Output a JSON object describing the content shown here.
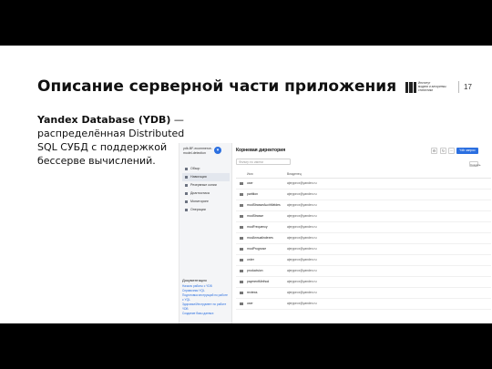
{
  "slide": {
    "title": "Описание серверной части приложения",
    "page_number": "17",
    "logo_text": "Институт\nмодели и алгоритмы\nстатистики",
    "desc_bold": "Yandex Database (YDB)",
    "desc_rest": " — распределённая Distributed SQL СУБД с поддержкой бессерве вычислений."
  },
  "console": {
    "db_name": "ydb-BF-ecommerce-\nmodel-detection",
    "nav": [
      {
        "label": "Обзор",
        "icon": "overview-icon"
      },
      {
        "label": "Навигация",
        "icon": "navigation-icon",
        "active": true
      },
      {
        "label": "Резервные копии",
        "icon": "backup-icon"
      },
      {
        "label": "Диагностика",
        "icon": "diagnostics-icon"
      },
      {
        "label": "Мониторинг",
        "icon": "monitoring-icon"
      },
      {
        "label": "Операции",
        "icon": "operations-icon"
      }
    ],
    "docs_heading": "Документация",
    "docs_links": [
      "Начало работы с YDB",
      "Справочник YQL",
      "Подготовка инструкций по работе с YQL",
      "Здоровье/Инструмент по работе YDB",
      "Создание базы данных"
    ],
    "page_title": "Корневая директория",
    "search_placeholder": "Фильтр по имени",
    "primary_button": "Ydb запрос",
    "secondary_button": "Создать",
    "columns": [
      "Имя",
      "Владелец"
    ],
    "rows": [
      {
        "name": "user",
        "owner": "ajerpprox@yandex.ru"
      },
      {
        "name": "partition",
        "owner": "ajerpprox@yandex.ru"
      },
      {
        "name": "modStrasseAuchMeldes",
        "owner": "ajerpprox@yandex.ru"
      },
      {
        "name": "modStrasse",
        "owner": "ajerpprox@yandex.ru"
      },
      {
        "name": "modFrequency",
        "owner": "ajerpprox@yandex.ru"
      },
      {
        "name": "modAnnualindexes",
        "owner": "ajerpprox@yandex.ru"
      },
      {
        "name": "modPrognose",
        "owner": "ajerpprox@yandex.ru"
      },
      {
        "name": "order",
        "owner": "ajerpprox@yandex.ru"
      },
      {
        "name": "productsion",
        "owner": "ajerpprox@yandex.ru"
      },
      {
        "name": "paymentMethod",
        "owner": "ajerpprox@yandex.ru"
      },
      {
        "name": "reviews",
        "owner": "ajerpprox@yandex.ru"
      },
      {
        "name": "user",
        "owner": "ajerpprox@yandex.ru"
      }
    ]
  }
}
